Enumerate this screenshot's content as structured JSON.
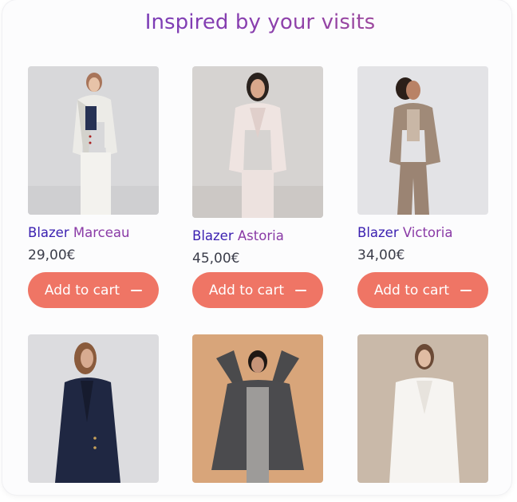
{
  "section": {
    "title": "Inspired by your visits"
  },
  "products": [
    {
      "brand": "Blazer",
      "model": "Marceau",
      "price": "29,00€",
      "button_label": "Add to cart",
      "button_icon": "minus-icon"
    },
    {
      "brand": "Blazer",
      "model": "Astoria",
      "price": "45,00€",
      "button_label": "Add to cart",
      "button_icon": "minus-icon"
    },
    {
      "brand": "Blazer",
      "model": "Victoria",
      "price": "34,00€",
      "button_label": "Add to cart",
      "button_icon": "minus-icon"
    },
    {
      "photo": "woman in navy blazer"
    },
    {
      "photo": "woman in grey oversized blazer"
    },
    {
      "photo": "woman in white blazer"
    }
  ],
  "colors": {
    "accent_button": "#ef7565",
    "brand_text": "#3a1fb0",
    "model_text": "#8a3aa6",
    "price_text": "#3b3d4a"
  }
}
